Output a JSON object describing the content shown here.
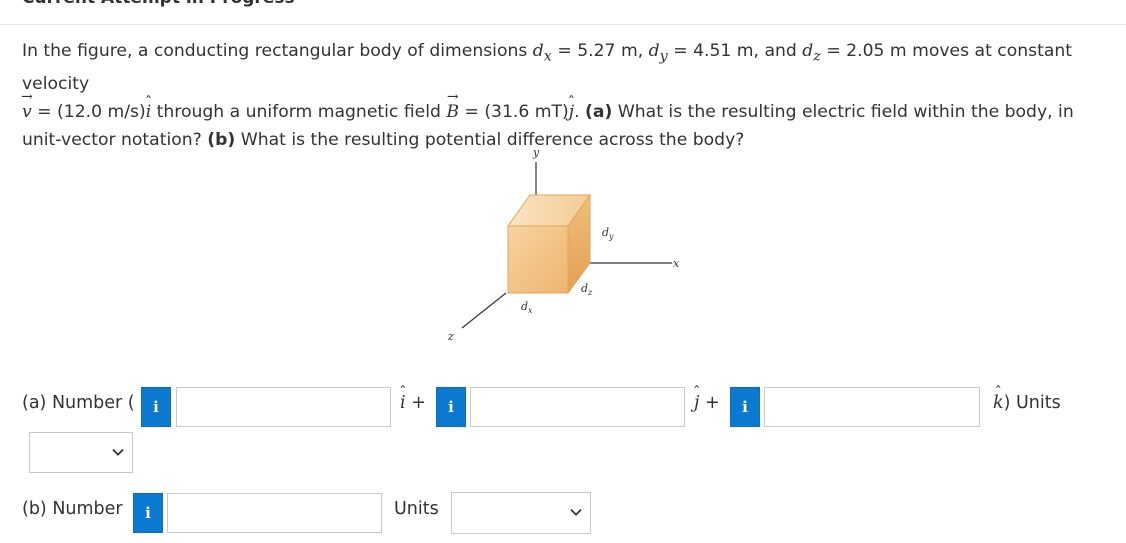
{
  "header": {
    "title": "Current Attempt in Progress"
  },
  "question": {
    "p1": "In the figure, a conducting rectangular body of dimensions ",
    "dx_sym": "d",
    "dx_sub": "x",
    "dx_val": " = 5.27 m, ",
    "dy_sym": "d",
    "dy_sub": "y",
    "dy_val": " = 4.51 m, and ",
    "dz_sym": "d",
    "dz_sub": "z",
    "dz_val": " = 2.05 m moves at constant velocity",
    "v_sym": "v",
    "v_val": " = (12.0 m/s)",
    "i_sym": "i",
    "p2": " through a uniform magnetic field ",
    "b_sym": "B",
    "b_val": " = (31.6 mT)",
    "j_sym": "j",
    "p3": ". ",
    "a_label": "(a)",
    "a_text": " What is the resulting electric field within the body, in unit-vector notation? ",
    "b_label": "(b)",
    "b_text": " What is the resulting potential difference across the body?"
  },
  "figure": {
    "axis_y": "y",
    "axis_x": "x",
    "axis_z": "z",
    "label_dx": "d",
    "label_dx_sub": "x",
    "label_dy": "d",
    "label_dy_sub": "y",
    "label_dz": "d",
    "label_dz_sub": "z"
  },
  "part_a": {
    "label": "(a) Number (",
    "info": "i",
    "i_hat": "i",
    "plus1": "+",
    "j_hat": "j",
    "plus2": "+",
    "k_hat": "k",
    "close_units": ") Units"
  },
  "part_b": {
    "label": "(b) Number",
    "info": "i",
    "units": "Units"
  },
  "colors": {
    "info_button": "#0b79d0",
    "cube_front": "#f3c48a",
    "cube_top": "#f7d7a8",
    "cube_side": "#e8ad66"
  }
}
